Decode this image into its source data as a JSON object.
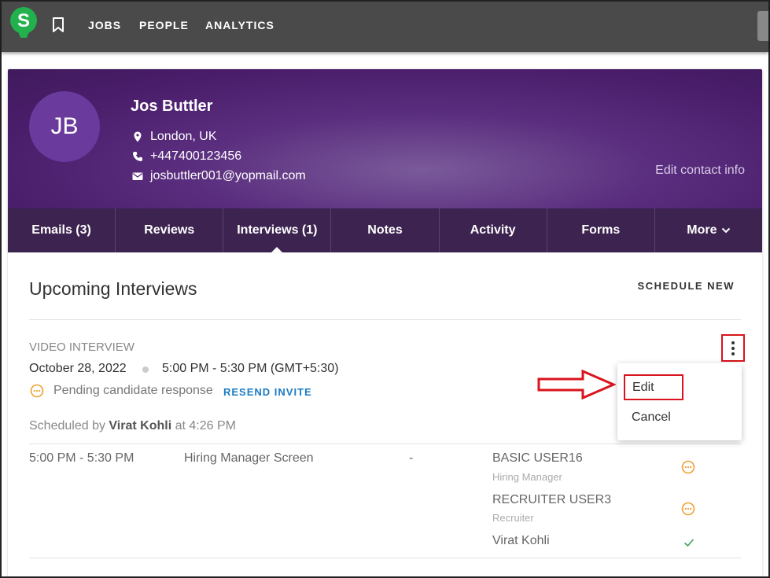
{
  "nav": {
    "logo_letter": "S",
    "links": [
      "JOBS",
      "PEOPLE",
      "ANALYTICS"
    ]
  },
  "candidate": {
    "initials": "JB",
    "name": "Jos Buttler",
    "location": "London, UK",
    "phone": "+447400123456",
    "email": "josbuttler001@yopmail.com",
    "edit_contact_label": "Edit contact info"
  },
  "tabs": [
    {
      "label": "Emails (3)",
      "active": false
    },
    {
      "label": "Reviews",
      "active": false
    },
    {
      "label": "Interviews (1)",
      "active": true
    },
    {
      "label": "Notes",
      "active": false
    },
    {
      "label": "Activity",
      "active": false
    },
    {
      "label": "Forms",
      "active": false
    },
    {
      "label": "More",
      "active": false
    }
  ],
  "interviews": {
    "section_title": "Upcoming Interviews",
    "schedule_new_label": "SCHEDULE NEW",
    "item": {
      "type": "VIDEO INTERVIEW",
      "date": "October 28, 2022",
      "time": "5:00 PM - 5:30 PM (GMT+5:30)",
      "pending_text": "Pending candidate response",
      "resend_label": "RESEND INVITE",
      "scheduled_by_prefix": "Scheduled by",
      "scheduled_by_name": "Virat Kohli",
      "scheduled_by_suffix": "at 4:26 PM",
      "slot": {
        "time": "5:00 PM - 5:30 PM",
        "name": "Hiring Manager Screen",
        "location": "-",
        "participants": [
          {
            "name": "BASIC USER16",
            "role": "Hiring Manager",
            "status": "pending"
          },
          {
            "name": "RECRUITER USER3",
            "role": "Recruiter",
            "status": "pending"
          },
          {
            "name": "Virat Kohli",
            "role": "",
            "status": "accepted"
          }
        ]
      }
    },
    "menu": {
      "edit_label": "Edit",
      "cancel_label": "Cancel"
    }
  },
  "colors": {
    "nav_bg": "#4a4a4a",
    "logo_green": "#22b14c",
    "header_purple": "#5a2d7e",
    "tabs_bg": "#3c2350",
    "link_blue": "#1a7bc4",
    "pending_orange": "#f0a030",
    "accepted_green": "#3aa357",
    "highlight_red": "#d9141c"
  }
}
